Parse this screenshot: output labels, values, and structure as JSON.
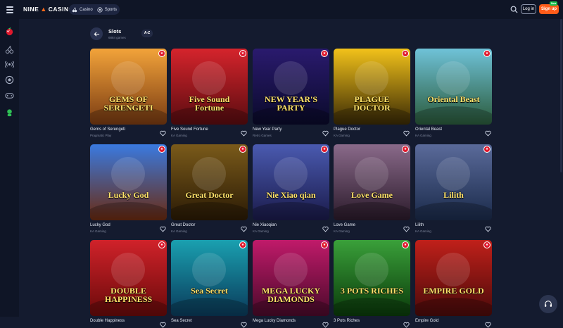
{
  "brand": {
    "name_left": "NINE",
    "name_right": "CASINO",
    "accent": "#ff5c1a"
  },
  "topnav": {
    "casino": "Casino",
    "sports": "Sports",
    "login": "Log in",
    "signup": "Sign up",
    "new_badge": "New"
  },
  "page": {
    "title": "Slots",
    "subtitle": "6884 games",
    "sort": "A-Z"
  },
  "games": [
    {
      "name": "Gems of Serengeti",
      "provider": "Pragmatic Play",
      "art": "GEMS OF SERENGETI",
      "colors": [
        "#f2a33a",
        "#7a3b12"
      ]
    },
    {
      "name": "Five Sound Fortune",
      "provider": "KA Gaming",
      "art": "Five Sound Fortune",
      "colors": [
        "#d5242c",
        "#5a0c10"
      ]
    },
    {
      "name": "New Year Party",
      "provider": "Retro Games",
      "art": "NEW YEAR'S PARTY",
      "colors": [
        "#2a1a6e",
        "#0a0a2a"
      ]
    },
    {
      "name": "Plague Doctor",
      "provider": "KA Gaming",
      "art": "PLAGUE DOCTOR",
      "colors": [
        "#f2c21a",
        "#3a2a05"
      ]
    },
    {
      "name": "Oriental Beast",
      "provider": "KA Gaming",
      "art": "Oriental Beast",
      "colors": [
        "#6fc2d8",
        "#2a5a3a"
      ]
    },
    {
      "name": "Lucky God",
      "provider": "KA Gaming",
      "art": "Lucky God",
      "colors": [
        "#3a7ae0",
        "#6a2a10"
      ]
    },
    {
      "name": "Great Doctor",
      "provider": "KA Gaming",
      "art": "Great Doctor",
      "colors": [
        "#7a5a1a",
        "#2a1a05"
      ]
    },
    {
      "name": "Nie Xiaoqian",
      "provider": "KA Gaming",
      "art": "Nie Xiao qian",
      "colors": [
        "#4a5ab0",
        "#1a1a4a"
      ]
    },
    {
      "name": "Love Game",
      "provider": "KA Gaming",
      "art": "Love Game",
      "colors": [
        "#8a6a8a",
        "#2a1a2a"
      ]
    },
    {
      "name": "Lilith",
      "provider": "KA Gaming",
      "art": "Lilith",
      "colors": [
        "#5a6a9a",
        "#1a2a4a"
      ]
    },
    {
      "name": "Double Happiness",
      "provider": "",
      "art": "DOUBLE HAPPINESS",
      "colors": [
        "#d0222a",
        "#6a0a0a"
      ]
    },
    {
      "name": "Sea Secret",
      "provider": "",
      "art": "Sea Secret",
      "colors": [
        "#1aa0b0",
        "#0a3a5a"
      ]
    },
    {
      "name": "Mega Lucky Diamonds",
      "provider": "",
      "art": "MEGA LUCKY DIAMONDS",
      "colors": [
        "#c01a6a",
        "#4a0a2a"
      ]
    },
    {
      "name": "3 Pots Riches",
      "provider": "",
      "art": "3 POTS RICHES",
      "colors": [
        "#3aa03a",
        "#0a3a0a"
      ]
    },
    {
      "name": "Empire Gold",
      "provider": "",
      "art": "EMPIRE GOLD",
      "colors": [
        "#c0201a",
        "#4a0a0a"
      ]
    }
  ]
}
